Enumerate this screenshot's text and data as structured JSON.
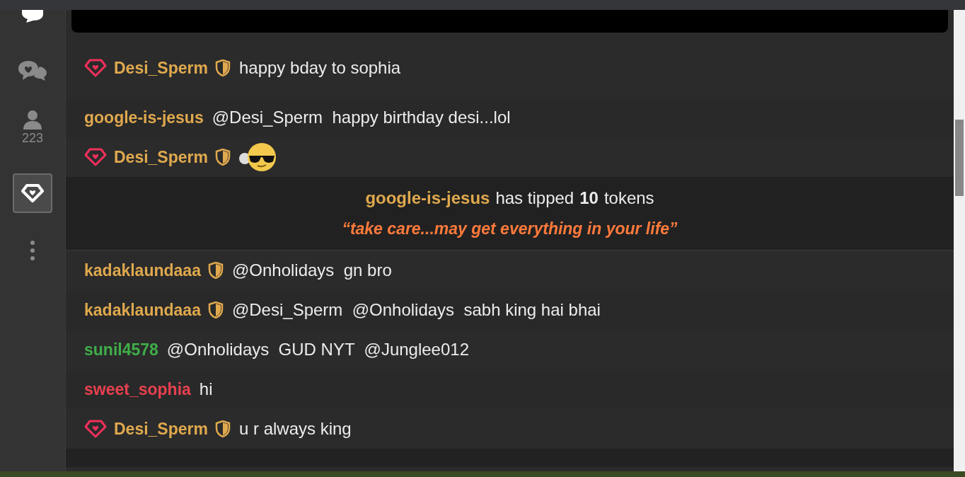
{
  "sidebar": {
    "viewer_count": "223",
    "items": [
      {
        "kind": "chats",
        "selected": false
      },
      {
        "kind": "viewers",
        "selected": false
      },
      {
        "kind": "diamond",
        "selected": true
      },
      {
        "kind": "more",
        "selected": false
      }
    ]
  },
  "messages": [
    {
      "kind": "chat",
      "user": "Desi_Sperm",
      "color": "#e0a94e",
      "diamond": true,
      "shield": true,
      "text": "happy bday to sophia"
    },
    {
      "kind": "chat",
      "user": "google-is-jesus",
      "color": "#e0a94e",
      "diamond": false,
      "shield": false,
      "text": "@Desi_Sperm  happy birthday desi...lol"
    },
    {
      "kind": "emoji",
      "user": "Desi_Sperm",
      "color": "#e0a94e",
      "diamond": true,
      "shield": true
    },
    {
      "kind": "tip",
      "user": "google-is-jesus",
      "color": "#e0a94e",
      "action": "has tipped",
      "amount": "10",
      "unit": "tokens",
      "note": "“take care...may get everything in your life”"
    },
    {
      "kind": "chat",
      "user": "kadaklaundaaa",
      "color": "#e0a94e",
      "diamond": false,
      "shield": true,
      "text": "@Onholidays  gn bro"
    },
    {
      "kind": "chat",
      "user": "kadaklaundaaa",
      "color": "#e0a94e",
      "diamond": false,
      "shield": true,
      "text": "@Desi_Sperm  @Onholidays  sabh king hai bhai"
    },
    {
      "kind": "chat",
      "user": "sunil4578",
      "color": "#3fae49",
      "diamond": false,
      "shield": false,
      "text": "@Onholidays  GUD NYT  @Junglee012"
    },
    {
      "kind": "chat",
      "user": "sweet_sophia",
      "color": "#e8404f",
      "diamond": false,
      "shield": false,
      "text": "hi"
    },
    {
      "kind": "chat",
      "user": "Desi_Sperm",
      "color": "#e0a94e",
      "diamond": true,
      "shield": true,
      "text": "u r always king"
    }
  ]
}
